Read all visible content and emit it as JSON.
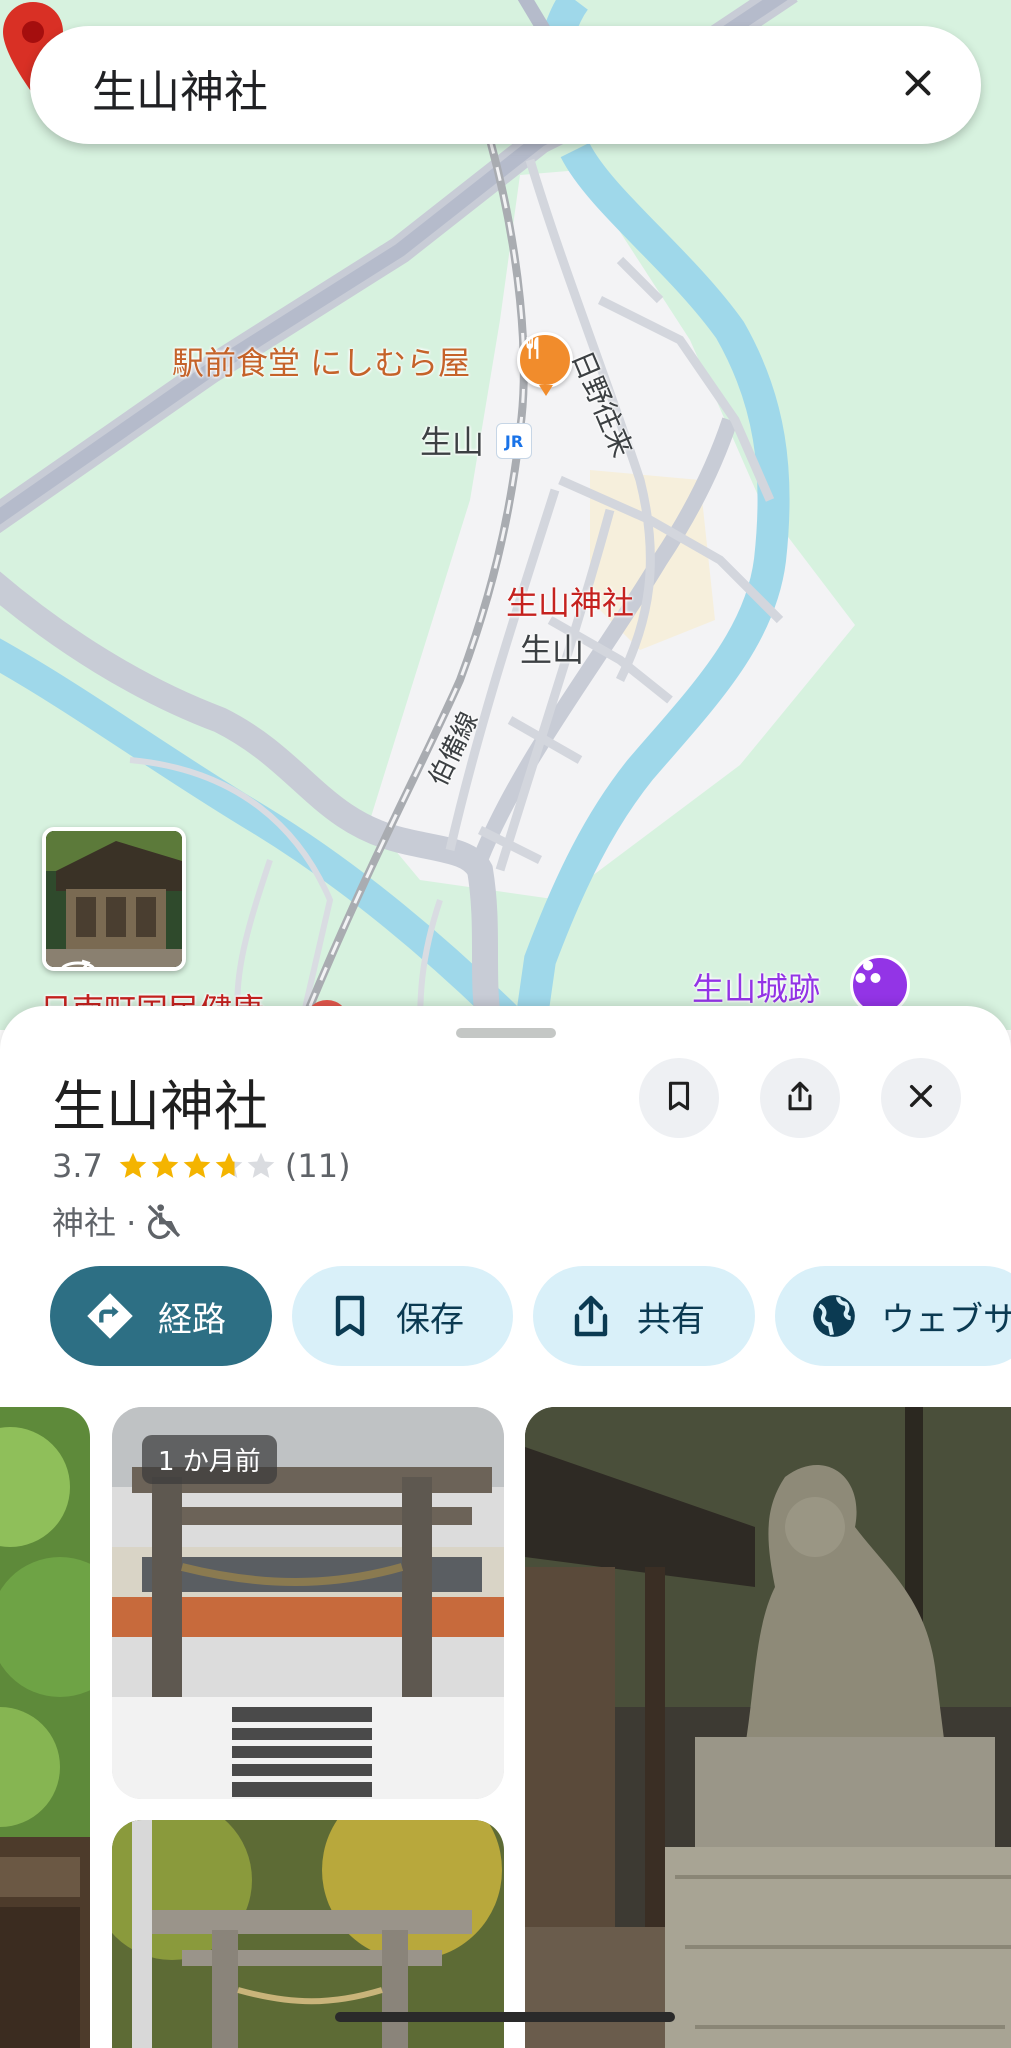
{
  "search": {
    "query": "生山神社"
  },
  "map": {
    "labels": {
      "restaurant": "駅前食堂 にしむら屋",
      "station": "生山",
      "station_badge": "JR",
      "shrine": "生山神社",
      "area": "生山",
      "street": "日野往来",
      "rail_line": "伯備線",
      "castle": "生山城跡",
      "hospital": "日南町国民健康"
    }
  },
  "place": {
    "title": "生山神社",
    "rating": "3.7",
    "stars_value": 3.7,
    "review_count": "(11)",
    "category": "神社 ·"
  },
  "actions": [
    {
      "label": "経路",
      "icon": "directions-icon"
    },
    {
      "label": "保存",
      "icon": "bookmark-icon"
    },
    {
      "label": "共有",
      "icon": "share-icon"
    },
    {
      "label": "ウェブサ",
      "icon": "globe-icon"
    }
  ],
  "photos": {
    "recent_label": "1 か月前"
  },
  "colors": {
    "primary_chip": "#2d6f84",
    "chip": "#d9f0f9",
    "map_bg": "#d7f2df",
    "river": "#9fd8ea",
    "pin": "#d93025"
  }
}
